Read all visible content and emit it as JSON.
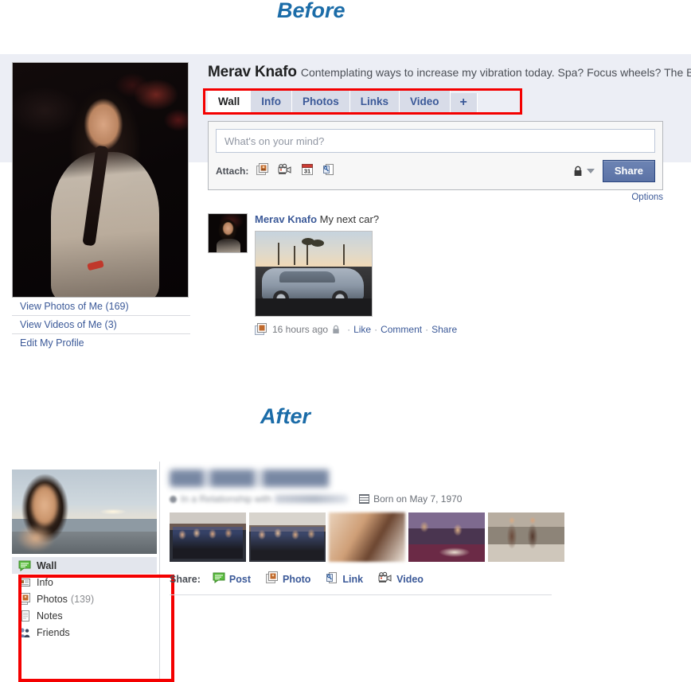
{
  "sections": {
    "before_caption": "Before",
    "after_caption": "After"
  },
  "before": {
    "profile": {
      "name": "Merav Knafo",
      "status": "Contemplating ways to increase my vibration today. Spa? Focus wheels? The Be",
      "photo_alt": "profile-photo"
    },
    "side_links": [
      {
        "label": "View Photos of Me (169)"
      },
      {
        "label": "View Videos of Me (3)"
      },
      {
        "label": "Edit My Profile"
      }
    ],
    "tabs": [
      {
        "label": "Wall",
        "active": true
      },
      {
        "label": "Info",
        "active": false
      },
      {
        "label": "Photos",
        "active": false
      },
      {
        "label": "Links",
        "active": false
      },
      {
        "label": "Video",
        "active": false
      },
      {
        "label": "+",
        "active": false
      }
    ],
    "composer": {
      "placeholder": "What's on your mind?",
      "attach_label": "Attach:",
      "attach_icons": [
        "photo-icon",
        "video-icon",
        "event-calendar-icon",
        "link-icon"
      ],
      "privacy_icon": "lock-icon",
      "share_button": "Share",
      "options_link": "Options"
    },
    "story": {
      "author": "Merav Knafo",
      "text": "My next car?",
      "photo_alt": "car-photo",
      "timestamp": "16 hours ago",
      "privacy_icon": "lock-icon",
      "actions": [
        "Like",
        "Comment",
        "Share"
      ],
      "separator": "·"
    }
  },
  "after": {
    "profile": {
      "name_blurred": "",
      "relationship_text": "In a Relationship with",
      "relationship_partner_blurred": "",
      "birthday": "Born on May 7, 1970"
    },
    "thumbnails": [
      {
        "alt": "group-photo-1"
      },
      {
        "alt": "group-photo-2"
      },
      {
        "alt": "closeup-photo-3"
      },
      {
        "alt": "party-photo-4"
      },
      {
        "alt": "beach-photo-5"
      }
    ],
    "menu": [
      {
        "label": "Wall",
        "icon": "wall-icon",
        "count": "",
        "selected": true
      },
      {
        "label": "Info",
        "icon": "info-icon",
        "count": "",
        "selected": false
      },
      {
        "label": "Photos",
        "icon": "photos-icon",
        "count": "(139)",
        "selected": false
      },
      {
        "label": "Notes",
        "icon": "notes-icon",
        "count": "",
        "selected": false
      },
      {
        "label": "Friends",
        "icon": "friends-icon",
        "count": "",
        "selected": false
      }
    ],
    "share": {
      "label": "Share:",
      "items": [
        {
          "label": "Post",
          "icon": "post-icon"
        },
        {
          "label": "Photo",
          "icon": "photo-icon"
        },
        {
          "label": "Link",
          "icon": "link-icon"
        },
        {
          "label": "Video",
          "icon": "video-icon"
        }
      ]
    }
  },
  "colors": {
    "accent_blue": "#3b5998",
    "caption_blue": "#1b6ca8",
    "highlight_red": "#f40000",
    "panel_bg": "#eceef5",
    "tab_bg": "#d8dce8"
  }
}
